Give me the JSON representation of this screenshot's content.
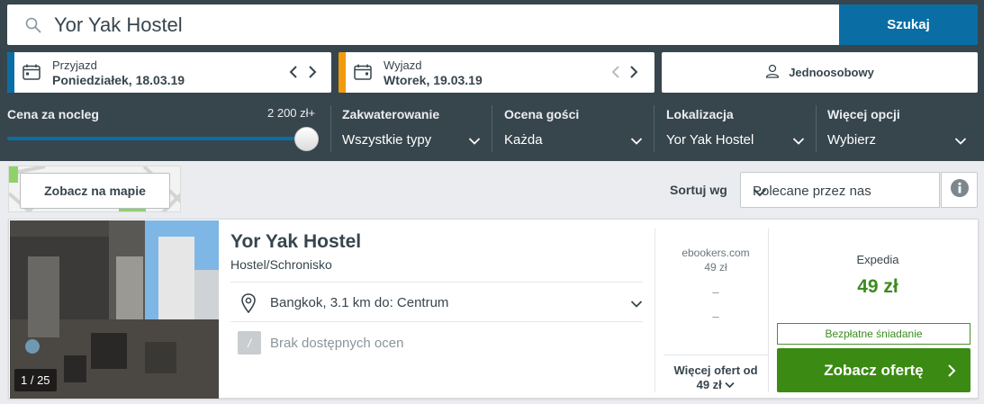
{
  "search": {
    "value": "Yor Yak Hostel",
    "button_label": "Szukaj"
  },
  "checkin": {
    "label": "Przyjazd",
    "date": "Poniedziałek, 18.03.19",
    "accent_color": "#0a6ea5"
  },
  "checkout": {
    "label": "Wyjazd",
    "date": "Wtorek, 19.03.19",
    "accent_color": "#f29a0e"
  },
  "room": {
    "label": "Jednoosobowy",
    "icon": "person-icon"
  },
  "filters": {
    "price": {
      "label": "Cena za nocleg",
      "max": "2 200 zł+",
      "slider_fraction": 1.0
    },
    "accommodation": {
      "label": "Zakwaterowanie",
      "value": "Wszystkie typy"
    },
    "rating": {
      "label": "Ocena gości",
      "value": "Każda"
    },
    "location": {
      "label": "Lokalizacja",
      "value": "Yor Yak Hostel"
    },
    "more": {
      "label": "Więcej opcji",
      "value": "Wybierz"
    }
  },
  "map": {
    "button_label": "Zobacz na mapie"
  },
  "sort": {
    "label": "Sortuj wg",
    "value": "Polecane przez nas"
  },
  "result": {
    "name": "Yor Yak Hostel",
    "type": "Hostel/Schronisko",
    "photo_count": "1 / 25",
    "location": "Bangkok, 3.1 km do: Centrum",
    "rating_badge": "/",
    "rating_text": "Brak dostępnych ocen",
    "alt_site": "ebookers.com",
    "alt_price": "49 zł",
    "alt_dash_1": "–",
    "alt_dash_2": "–",
    "more_offers_line1": "Więcej ofert od",
    "more_offers_line2": "49 zł",
    "deal_site": "Expedia",
    "deal_price": "49 zł",
    "deal_badge": "Bezpłatne śniadanie",
    "deal_button": "Zobacz ofertę",
    "price_color": "#3c8b1f"
  }
}
